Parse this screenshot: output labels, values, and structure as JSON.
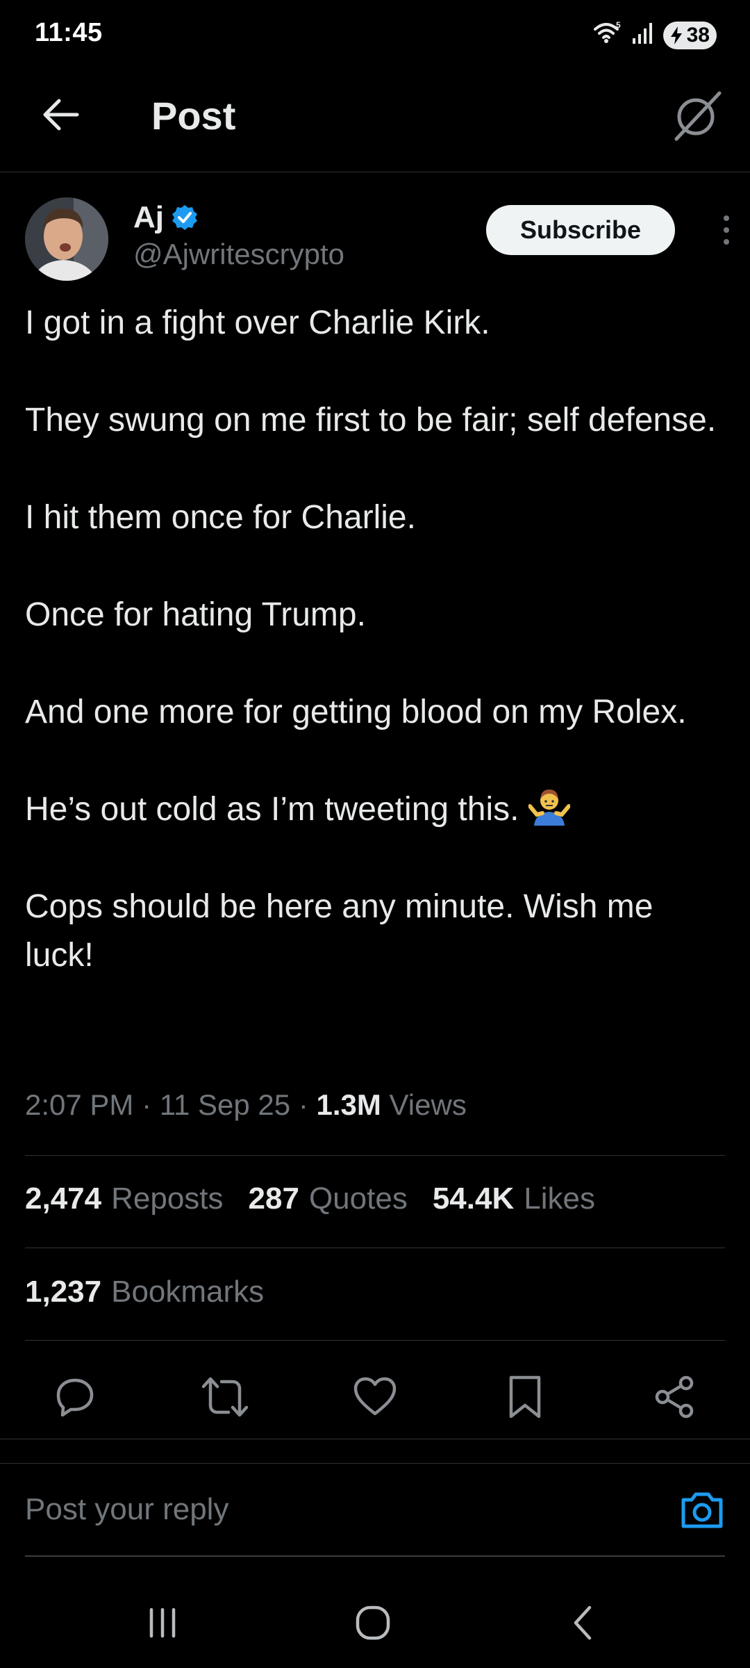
{
  "status_bar": {
    "time": "11:45",
    "wifi_label": "5",
    "battery": "38"
  },
  "top_bar": {
    "title": "Post"
  },
  "author": {
    "name": "Aj",
    "handle": "@Ajwritescrypto",
    "verified": true,
    "subscribe_label": "Subscribe"
  },
  "post": {
    "paragraphs": [
      "I got in a fight over Charlie Kirk.",
      "They swung on me first to be fair; self defense.",
      "I hit them once for Charlie.",
      "Once for hating Trump.",
      "And one more for getting blood on my Rolex.",
      "He’s out cold as I’m tweeting this.",
      "Cops should be here any minute. Wish me luck!"
    ],
    "emoji": "shrugging-person-emoji",
    "time": "2:07 PM",
    "date": "11 Sep 25",
    "views_count": "1.3M",
    "views_label": "Views",
    "separator": "·"
  },
  "stats": {
    "reposts_count": "2,474",
    "reposts_label": "Reposts",
    "quotes_count": "287",
    "quotes_label": "Quotes",
    "likes_count": "54.4K",
    "likes_label": "Likes",
    "bookmarks_count": "1,237",
    "bookmarks_label": "Bookmarks"
  },
  "actions": [
    "reply-icon",
    "repost-icon",
    "like-icon",
    "bookmark-icon",
    "share-icon"
  ],
  "reply": {
    "placeholder": "Post your reply"
  },
  "colors": {
    "background": "#000000",
    "text": "#e7e9ea",
    "muted": "#71767b",
    "accent": "#1d9bf0",
    "divider": "#2f3336"
  }
}
